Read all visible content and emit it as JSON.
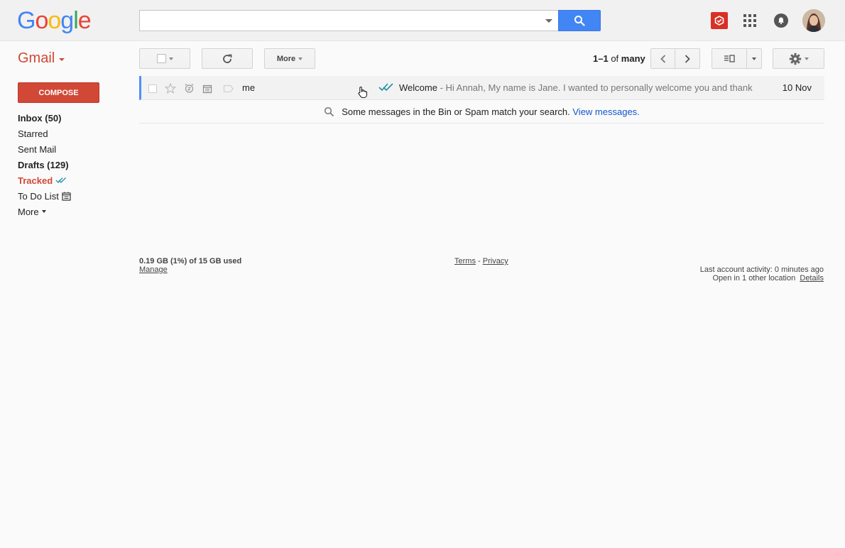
{
  "header": {
    "logo_letters": [
      "G",
      "o",
      "o",
      "g",
      "l",
      "e"
    ],
    "logo_colors": [
      "#4285f4",
      "#ea4335",
      "#fbbc05",
      "#4285f4",
      "#34a853",
      "#ea4335"
    ],
    "search_value": "",
    "icons": [
      "search-icon",
      "extension-icon",
      "apps-icon",
      "notifications-icon",
      "avatar"
    ]
  },
  "app": {
    "label": "Gmail",
    "accent": "#d14836"
  },
  "toolbar": {
    "more_label": "More",
    "pager_range": "1–1",
    "pager_of": "of",
    "pager_total": "many"
  },
  "sidebar": {
    "compose_label": "COMPOSE",
    "items": [
      {
        "label": "Inbox (50)"
      },
      {
        "label": "Starred"
      },
      {
        "label": "Sent Mail"
      },
      {
        "label": "Drafts (129)"
      },
      {
        "label": "Tracked"
      },
      {
        "label": "To Do List"
      },
      {
        "label": "More"
      }
    ]
  },
  "messages": [
    {
      "sender": "me",
      "subject": "Welcome",
      "snippet": " - Hi Annah, My name is Jane. I wanted to personally welcome you and thank",
      "date": "10 Nov"
    }
  ],
  "notice": {
    "text": "Some messages in the Bin or Spam match your search.",
    "link": "View messages."
  },
  "footer": {
    "storage": "0.19 GB (1%) of 15 GB used",
    "manage": "Manage",
    "terms": "Terms",
    "separator": "-",
    "privacy": "Privacy",
    "activity": "Last account activity: 0 minutes ago",
    "open_location": "Open in 1 other location",
    "details": "Details"
  }
}
